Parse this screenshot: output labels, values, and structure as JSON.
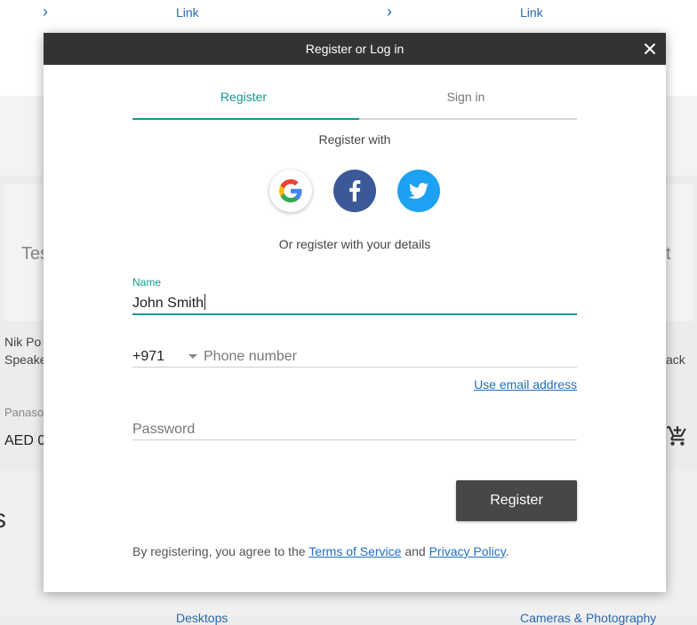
{
  "background": {
    "top_links": [
      "Link",
      "Link"
    ],
    "fragments": {
      "left_big": "Tes",
      "right_big": "t",
      "product_line1": "Nik Po",
      "product_line2": "Speake",
      "product_right": "ack",
      "brand": "Panaso",
      "price": "AED 0"
    },
    "section_heading": "s",
    "bottom_links": [
      "Desktops",
      "Cameras & Photography"
    ]
  },
  "modal": {
    "title": "Register or Log in",
    "close_icon": "close-icon",
    "tabs": [
      {
        "label": "Register",
        "active": true
      },
      {
        "label": "Sign in",
        "active": false
      }
    ],
    "register_with": "Register with",
    "social": [
      {
        "name": "google",
        "icon": "google-icon",
        "color": "#ffffff"
      },
      {
        "name": "facebook",
        "icon": "facebook-icon",
        "color": "#3b5998"
      },
      {
        "name": "twitter",
        "icon": "twitter-icon",
        "color": "#1da1f2"
      }
    ],
    "or_details": "Or register with your details",
    "name_field": {
      "label": "Name",
      "value": "John Smith"
    },
    "phone_field": {
      "country_code": "+971",
      "placeholder": "Phone number"
    },
    "use_email": "Use email address",
    "password_field": {
      "placeholder": "Password"
    },
    "register_button": "Register",
    "terms": {
      "prefix": "By registering, you agree to the ",
      "tos": "Terms of Service",
      "and": " and ",
      "privacy": "Privacy Policy",
      "suffix": "."
    }
  },
  "colors": {
    "accent": "#129b8c",
    "link": "#1e6fc4",
    "header": "#333333",
    "button": "#474747"
  }
}
